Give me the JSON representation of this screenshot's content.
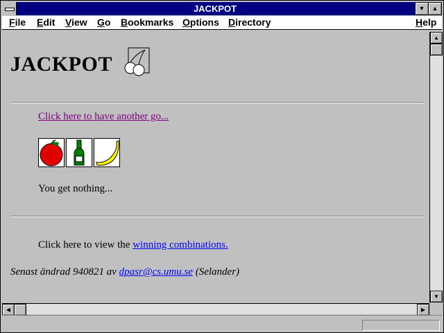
{
  "window": {
    "title": "JACKPOT"
  },
  "menubar": {
    "items": [
      {
        "label": "File"
      },
      {
        "label": "Edit"
      },
      {
        "label": "View"
      },
      {
        "label": "Go"
      },
      {
        "label": "Bookmarks"
      },
      {
        "label": "Options"
      },
      {
        "label": "Directory"
      },
      {
        "label": "Help"
      }
    ]
  },
  "page": {
    "heading": "JACKPOT",
    "heading_icon": "cherries-icon",
    "again_link": "Click here to have another go...",
    "slots": [
      {
        "icon": "apple-icon",
        "color": "#e00000"
      },
      {
        "icon": "bottle-icon",
        "color": "#008000"
      },
      {
        "icon": "banana-icon",
        "color": "#ffff00"
      }
    ],
    "result": "You get nothing...",
    "view_prefix": "Click here to view the ",
    "view_link": "winning combinations.",
    "footer_prefix": "Senast ändrad 940821 av ",
    "footer_link": "dpasr@cs.umu.se",
    "footer_suffix": " (Selander)"
  },
  "colors": {
    "titlebar": "#000080",
    "visited_link": "#800080",
    "link": "#0000ff",
    "background": "#c0c0c0"
  }
}
